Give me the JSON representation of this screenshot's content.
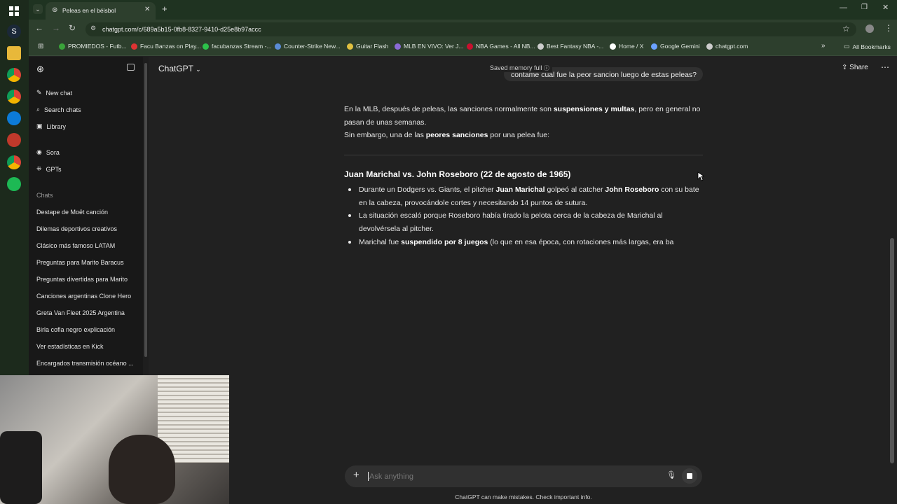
{
  "browser": {
    "tab_title": "Peleas en el béisbol",
    "url": "chatgpt.com/c/689a5b15-0fb8-8327-9410-d25e8b97accc",
    "bookmarks": [
      {
        "label": "PROMIEDOS - Futb...",
        "color": "#3aa33a"
      },
      {
        "label": "Facu Banzas on Play...",
        "color": "#d33"
      },
      {
        "label": "facubanzas Stream -...",
        "color": "#2cc24a"
      },
      {
        "label": "Counter-Strike New...",
        "color": "#5a8bd6"
      },
      {
        "label": "Guitar Flash",
        "color": "#e0c040"
      },
      {
        "label": "MLB EN VIVO: Ver J...",
        "color": "#8a6ad6"
      },
      {
        "label": "NBA Games - All NB...",
        "color": "#c8102e"
      },
      {
        "label": "Best Fantasy NBA -...",
        "color": "#cccccc"
      },
      {
        "label": "Home / X",
        "color": "#ffffff"
      },
      {
        "label": "Google Gemini",
        "color": "#6aa0ff"
      },
      {
        "label": "chatgpt.com",
        "color": "#cccccc"
      }
    ],
    "all_bookmarks": "All Bookmarks"
  },
  "sidebar": {
    "nav": [
      {
        "label": "New chat",
        "icon": "edit-icon"
      },
      {
        "label": "Search chats",
        "icon": "search-icon"
      },
      {
        "label": "Library",
        "icon": "library-icon"
      },
      {
        "label": "Sora",
        "icon": "play-icon"
      },
      {
        "label": "GPTs",
        "icon": "grid-icon"
      }
    ],
    "chats_heading": "Chats",
    "chats": [
      "Destape de Moët canción",
      "Dilemas deportivos creativos",
      "Clásico más famoso LATAM",
      "Preguntas para Marito Baracus",
      "Preguntas divertidas para Marito",
      "Canciones argentinas Clone Hero",
      "Greta Van Fleet 2025 Argentina",
      "Birla cofla negro explicación",
      "Ver estadísticas en Kick",
      "Encargados transmisión océano ..."
    ]
  },
  "header": {
    "model": "ChatGPT",
    "memory": "Saved memory full",
    "share": "Share"
  },
  "conversation": {
    "user_message": "contame cual fue la peor sancion luego de estas peleas?",
    "p1_a": "En la MLB, después de peleas, las sanciones normalmente son ",
    "p1_b": "suspensiones y multas",
    "p1_c": ", pero en general no",
    "p1_d": "pasan de unas semanas.",
    "p2_a": "Sin embargo, una de las ",
    "p2_b": "peores sanciones",
    "p2_c": " por una pelea fue:",
    "heading": "Juan Marichal vs. John Roseboro (22 de agosto de 1965)",
    "b1_a": "Durante un Dodgers vs. Giants, el pitcher ",
    "b1_b": "Juan Marichal",
    "b1_c": " golpeó al catcher ",
    "b1_d": "John Roseboro",
    "b1_e": " con su bate",
    "b1_f": "en la cabeza, provocándole cortes y necesitando 14 puntos de sutura.",
    "b2_a": "La situación escaló porque Roseboro había tirado la pelota cerca de la cabeza de Marichal al",
    "b2_b": "devolvérsela al pitcher.",
    "b3_a": "Marichal fue ",
    "b3_b": "suspendido por 8 juegos",
    "b3_c": " (lo que en esa época, con rotaciones más largas, era ba"
  },
  "composer": {
    "placeholder": "Ask anything",
    "disclaimer": "ChatGPT can make mistakes. Check important info."
  }
}
